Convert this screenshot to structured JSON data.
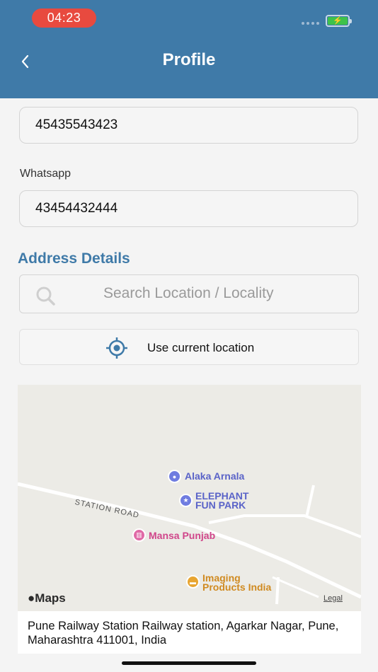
{
  "status_bar": {
    "time": "04:23"
  },
  "header": {
    "title": "Profile"
  },
  "form": {
    "phone_value": "45435543423",
    "whatsapp_label": "Whatsapp",
    "whatsapp_value": "43454432444"
  },
  "address": {
    "section_title": "Address Details",
    "search_placeholder": "Search Location / Locality",
    "use_current_location": "Use current location",
    "selected_address": "Pune Railway Station Railway station, Agarkar Nagar, Pune, Maharashtra 411001, India"
  },
  "map": {
    "road_label": "STATION ROAD",
    "pois": {
      "alaka": "Alaka Arnala",
      "elephant_line1": "ELEPHANT",
      "elephant_line2": "FUN PARK",
      "mansa": "Mansa Punjab",
      "imaging_line1": "Imaging",
      "imaging_line2": "Products India"
    },
    "attribution": "Maps",
    "legal": "Legal"
  },
  "colors": {
    "header": "#3f7aa8",
    "accent": "#3f7aa8",
    "time_pill": "#e84a3f",
    "battery": "#3ec24a"
  }
}
